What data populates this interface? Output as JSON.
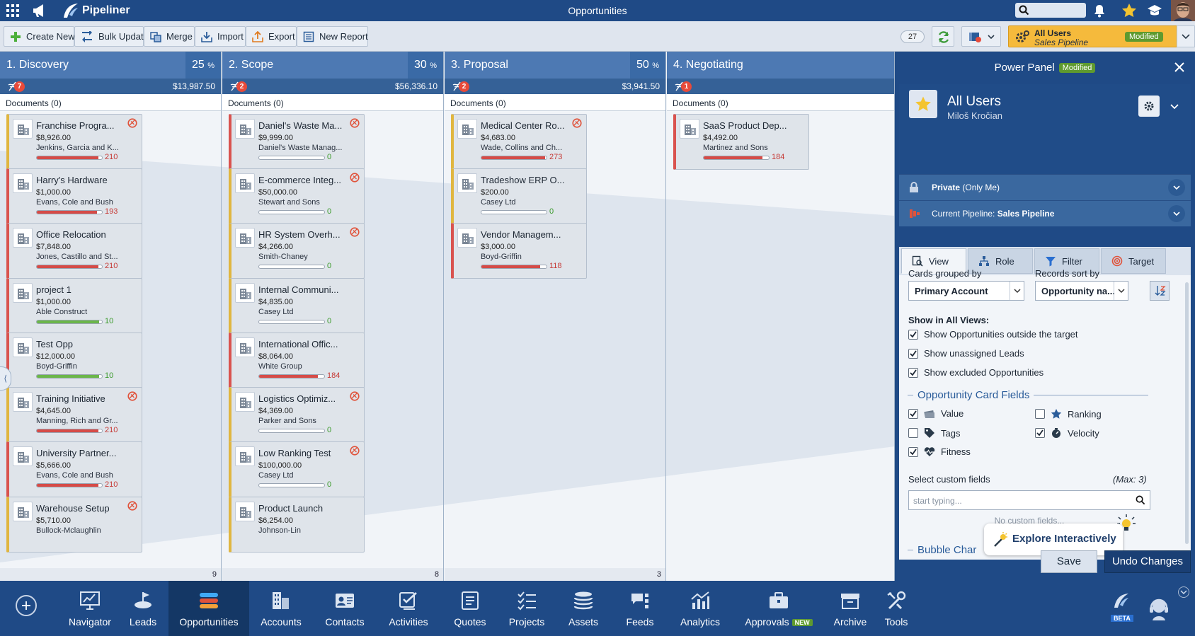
{
  "topbar": {
    "brand": "Pipeliner",
    "title": "Opportunities"
  },
  "toolbar": {
    "buttons": [
      "Create New",
      "Bulk Update",
      "Merge",
      "Import",
      "Export",
      "New Report"
    ],
    "record_count": "27",
    "pipeline": {
      "line1": "All Users",
      "line2": "Sales Pipeline",
      "badge": "Modified"
    }
  },
  "columns": [
    {
      "name": "1. Discovery",
      "pct": "25",
      "count": "7",
      "amount": "$13,987.50",
      "docs": "Documents (0)",
      "footer": "9",
      "cards": [
        {
          "title": "Franchise Progra...",
          "value": "$8,926.00",
          "account": "Jenkins, Garcia and K...",
          "score": "210",
          "fitness": 0.95,
          "tone": "r",
          "stale": true,
          "border": "yellow"
        },
        {
          "title": "Harry's Hardware",
          "value": "$1,000.00",
          "account": "Evans, Cole and Bush",
          "score": "193",
          "fitness": 0.92,
          "tone": "r",
          "stale": false,
          "border": "red"
        },
        {
          "title": "Office Relocation",
          "value": "$7,848.00",
          "account": "Jones, Castillo and St...",
          "score": "210",
          "fitness": 0.95,
          "tone": "r",
          "stale": false,
          "border": "red"
        },
        {
          "title": "project 1",
          "value": "$1,000.00",
          "account": "Able Construct",
          "score": "10",
          "fitness": 0.96,
          "tone": "g",
          "stale": false,
          "border": "red"
        },
        {
          "title": "Test Opp",
          "value": "$12,000.00",
          "account": "Boyd-Griffin",
          "score": "10",
          "fitness": 0.96,
          "tone": "g",
          "stale": false,
          "border": "red"
        },
        {
          "title": "Training Initiative",
          "value": "$4,645.00",
          "account": "Manning, Rich and Gr...",
          "score": "210",
          "fitness": 0.95,
          "tone": "r",
          "stale": true,
          "border": "yellow"
        },
        {
          "title": "University Partner...",
          "value": "$5,666.00",
          "account": "Evans, Cole and Bush",
          "score": "210",
          "fitness": 0.95,
          "tone": "r",
          "stale": false,
          "border": "red"
        },
        {
          "title": "Warehouse Setup",
          "value": "$5,710.00",
          "account": "Bullock-Mclaughlin",
          "score": "",
          "fitness": 0,
          "tone": "r",
          "stale": true,
          "border": "yellow"
        }
      ]
    },
    {
      "name": "2. Scope",
      "pct": "30",
      "count": "2",
      "amount": "$56,336.10",
      "docs": "Documents (0)",
      "footer": "8",
      "cards": [
        {
          "title": "Daniel's Waste Ma...",
          "value": "$9,999.00",
          "account": "Daniel's Waste Manag...",
          "score": "0",
          "fitness": 0,
          "tone": "g",
          "stale": true,
          "border": "red"
        },
        {
          "title": "E-commerce Integ...",
          "value": "$50,000.00",
          "account": "Stewart and Sons",
          "score": "0",
          "fitness": 0,
          "tone": "g",
          "stale": true,
          "border": "yellow"
        },
        {
          "title": "HR System Overh...",
          "value": "$4,266.00",
          "account": "Smith-Chaney",
          "score": "0",
          "fitness": 0,
          "tone": "g",
          "stale": true,
          "border": "yellow"
        },
        {
          "title": "Internal Communi...",
          "value": "$4,835.00",
          "account": "Casey Ltd",
          "score": "0",
          "fitness": 0,
          "tone": "g",
          "stale": false,
          "border": "yellow"
        },
        {
          "title": "International Offic...",
          "value": "$8,064.00",
          "account": "White Group",
          "score": "184",
          "fitness": 0.9,
          "tone": "r",
          "stale": false,
          "border": "red"
        },
        {
          "title": "Logistics Optimiz...",
          "value": "$4,369.00",
          "account": "Parker and Sons",
          "score": "0",
          "fitness": 0,
          "tone": "g",
          "stale": true,
          "border": "yellow"
        },
        {
          "title": "Low Ranking Test",
          "value": "$100,000.00",
          "account": "Casey Ltd",
          "score": "0",
          "fitness": 0,
          "tone": "g",
          "stale": true,
          "border": "yellow"
        },
        {
          "title": "Product Launch",
          "value": "$6,254.00",
          "account": "Johnson-Lin",
          "score": "",
          "fitness": 0,
          "tone": "g",
          "stale": false,
          "border": "yellow"
        }
      ]
    },
    {
      "name": "3. Proposal",
      "pct": "50",
      "count": "2",
      "amount": "$3,941.50",
      "docs": "Documents (0)",
      "footer": "3",
      "cards": [
        {
          "title": "Medical Center Ro...",
          "value": "$4,683.00",
          "account": "Wade, Collins and Ch...",
          "score": "273",
          "fitness": 0.98,
          "tone": "r",
          "stale": true,
          "border": "yellow"
        },
        {
          "title": "Tradeshow ERP O...",
          "value": "$200.00",
          "account": "Casey Ltd",
          "score": "0",
          "fitness": 0,
          "tone": "g",
          "stale": false,
          "border": "yellow"
        },
        {
          "title": "Vendor Managem...",
          "value": "$3,000.00",
          "account": "Boyd-Griffin",
          "score": "118",
          "fitness": 0.9,
          "tone": "r",
          "stale": false,
          "border": "red"
        }
      ]
    },
    {
      "name": "4. Negotiating",
      "pct": "",
      "count": "1",
      "amount": "",
      "docs": "Documents (0)",
      "footer": "",
      "cards": [
        {
          "title": "SaaS Product Dep...",
          "value": "$4,492.00",
          "account": "Martinez and Sons",
          "score": "184",
          "fitness": 0.9,
          "tone": "r",
          "stale": false,
          "border": "red"
        }
      ]
    }
  ],
  "power_panel": {
    "title": "Power Panel",
    "badge": "Modified",
    "profile_name": "All Users",
    "owner": "Miloš Kročian",
    "privacy_bold": "Private",
    "privacy_rest": " (Only Me)",
    "pipeline_prefix": "Current Pipeline: ",
    "pipeline_name": "Sales Pipeline",
    "tabs": [
      "View",
      "Role",
      "Filter",
      "Target"
    ],
    "cards_grouped_label": "Cards grouped by",
    "cards_grouped_value": "Primary Account",
    "sort_label": "Records sort by",
    "sort_value": "Opportunity na...",
    "show_all_title": "Show in All Views:",
    "show_opts": [
      {
        "label": "Show Opportunities outside the target",
        "checked": true
      },
      {
        "label": "Show unassigned Leads",
        "checked": true
      },
      {
        "label": "Show excluded Opportunities",
        "checked": true
      }
    ],
    "card_fields_title": "Opportunity Card Fields",
    "card_fields": [
      {
        "label": "Value",
        "checked": true,
        "icon": "money-icon"
      },
      {
        "label": "Ranking",
        "checked": false,
        "icon": "star-icon"
      },
      {
        "label": "Tags",
        "checked": false,
        "icon": "tag-icon"
      },
      {
        "label": "Velocity",
        "checked": true,
        "icon": "velocity-icon"
      },
      {
        "label": "Fitness",
        "checked": true,
        "icon": "heartbeat-icon"
      }
    ],
    "custom_label": "Select custom fields",
    "custom_max": "(Max: 3)",
    "custom_placeholder": "start typing...",
    "no_custom": "No custom fields...",
    "bubble_title": "Bubble Char",
    "explore": "Explore Interactively",
    "save": "Save",
    "undo": "Undo Changes"
  },
  "bottomnav": {
    "items": [
      "Navigator",
      "Leads",
      "Opportunities",
      "Accounts",
      "Contacts",
      "Activities",
      "Quotes",
      "Projects",
      "Assets",
      "Feeds",
      "Analytics",
      "Approvals",
      "Archive",
      "Tools"
    ],
    "new_badge": "NEW",
    "beta": "BETA"
  },
  "colors": {
    "primary": "#1f4a86",
    "column_head": "#4d79b3",
    "modified": "#5f9a2f",
    "pipeline": "#f5ba3c"
  }
}
